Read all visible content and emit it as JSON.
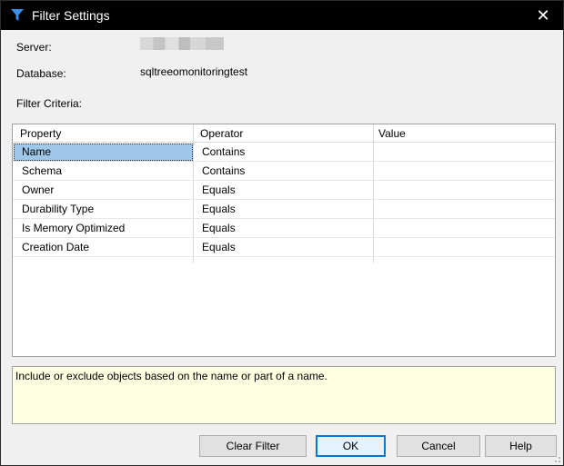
{
  "window": {
    "title": "Filter Settings",
    "close_glyph": "✕"
  },
  "labels": {
    "server": "Server:",
    "database": "Database:",
    "database_value": "sqltreeomonitoringtest",
    "filter_criteria": "Filter Criteria:"
  },
  "grid": {
    "columns": [
      "Property",
      "Operator",
      "Value"
    ],
    "rows": [
      {
        "property": "Name",
        "operator": "Contains",
        "value": ""
      },
      {
        "property": "Schema",
        "operator": "Contains",
        "value": ""
      },
      {
        "property": "Owner",
        "operator": "Equals",
        "value": ""
      },
      {
        "property": "Durability Type",
        "operator": "Equals",
        "value": ""
      },
      {
        "property": "Is Memory Optimized",
        "operator": "Equals",
        "value": ""
      },
      {
        "property": "Creation Date",
        "operator": "Equals",
        "value": ""
      }
    ],
    "selected_row": 0
  },
  "description": "Include or exclude objects based on the name or part of a name.",
  "buttons": {
    "clear_filter": "Clear Filter",
    "ok": "OK",
    "cancel": "Cancel",
    "help": "Help"
  },
  "icons": {
    "title_icon": "filter-funnel-icon",
    "close": "close-icon",
    "grip": "resize-grip-icon"
  },
  "colors": {
    "titlebar": "#000000",
    "selection": "#9ec7ea",
    "description_bg": "#ffffe1",
    "primary_border": "#0078d7"
  }
}
